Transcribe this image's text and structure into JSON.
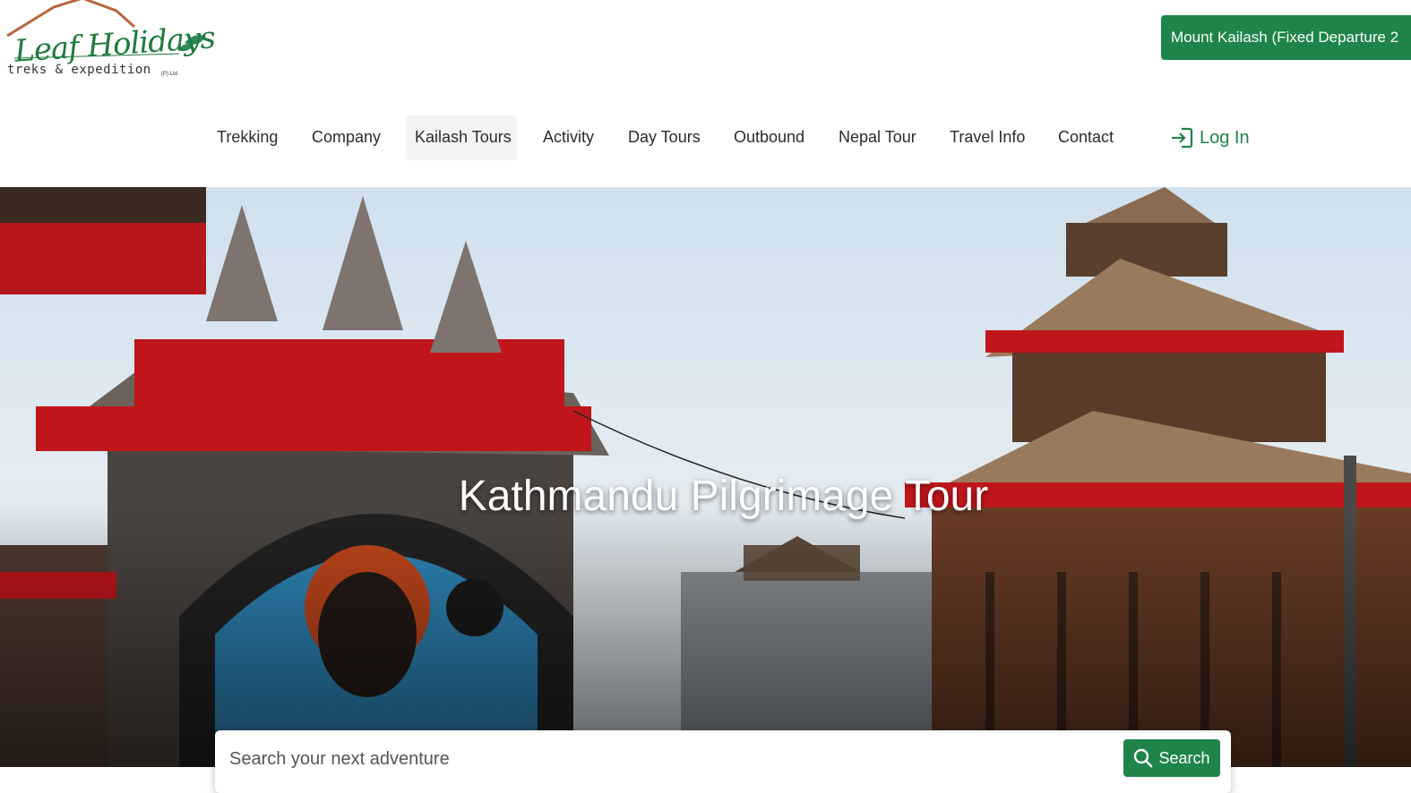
{
  "brand": {
    "name": "Leaf Holidays",
    "tagline": "treks & expedition",
    "suffix": "(P) Ltd"
  },
  "header": {
    "promo_label": "Mount Kailash (Fixed Departure 2"
  },
  "nav": {
    "items": [
      {
        "label": "Trekking"
      },
      {
        "label": "Company"
      },
      {
        "label": "Kailash Tours",
        "active": true
      },
      {
        "label": "Activity"
      },
      {
        "label": "Day Tours"
      },
      {
        "label": "Outbound"
      },
      {
        "label": "Nepal Tour"
      },
      {
        "label": "Travel Info"
      },
      {
        "label": "Contact"
      }
    ],
    "login_label": "Log In",
    "login_icon": "login-arrow-icon"
  },
  "hero": {
    "title": "Kathmandu Pilgrimage Tour"
  },
  "search": {
    "placeholder": "Search your next adventure",
    "button_label": "Search",
    "button_icon": "search-icon"
  },
  "colors": {
    "accent": "#1e8449"
  }
}
